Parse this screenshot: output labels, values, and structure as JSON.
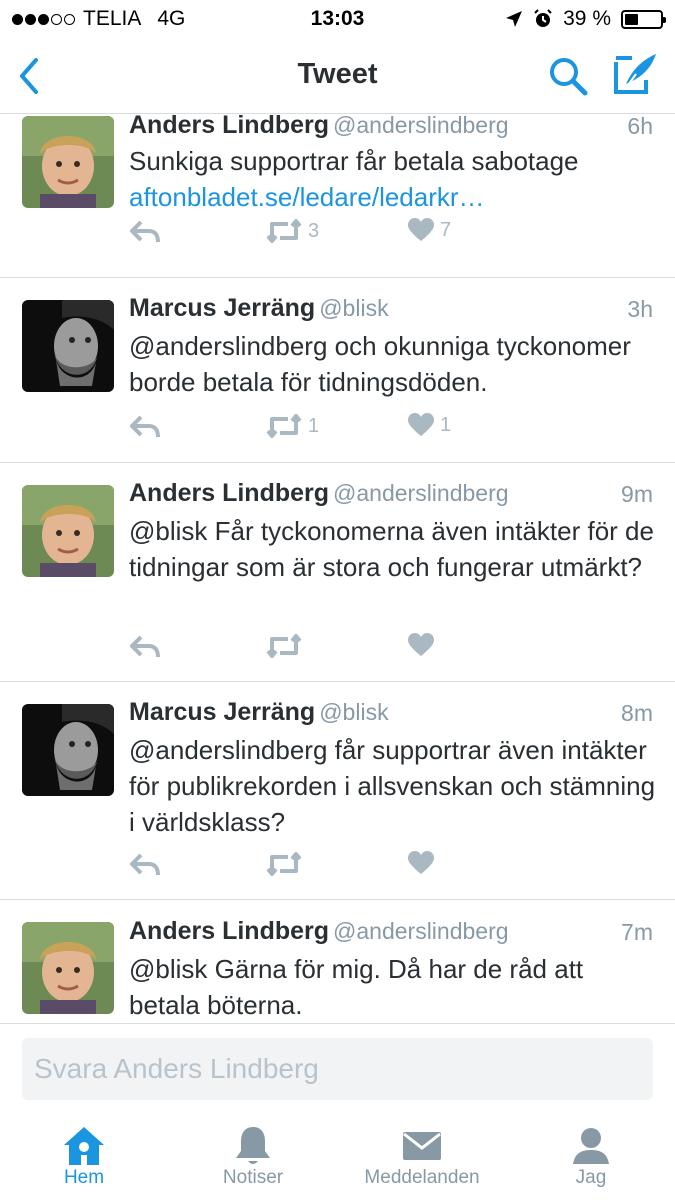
{
  "status_bar": {
    "carrier": "TELIA",
    "network": "4G",
    "time": "13:03",
    "battery": "39 %",
    "battery_level": 0.39
  },
  "nav": {
    "title": "Tweet",
    "icons": [
      "back-icon",
      "search-icon",
      "compose-icon"
    ],
    "accent_color": "#1b95e0"
  },
  "tweets": [
    {
      "name": "Anders Lindberg",
      "handle": "@anderslindberg",
      "time": "6h",
      "text": "Sunkiga supportrar får betala sabotage",
      "link": "aftonbladet.se/ledare/ledarkr…",
      "retweets": "3",
      "likes": "7"
    },
    {
      "name": "Marcus Jerräng",
      "handle": "@blisk",
      "time": "3h",
      "text": "@anderslindberg och okunniga tyckonomer borde betala för tidningsdöden.",
      "retweets": "1",
      "likes": "1"
    },
    {
      "name": "Anders Lindberg",
      "handle": "@anderslindberg",
      "time": "9m",
      "text": "@blisk Får tyckonomerna även intäkter för de tidningar som är stora och fungerar utmärkt?",
      "retweets": "",
      "likes": ""
    },
    {
      "name": "Marcus Jerräng",
      "handle": "@blisk",
      "time": "8m",
      "text": "@anderslindberg får supportrar även intäkter för publikrekorden i allsvenskan och stämning i världsklass?",
      "retweets": "",
      "likes": ""
    },
    {
      "name": "Anders Lindberg",
      "handle": "@anderslindberg",
      "time": "7m",
      "text": "@blisk Gärna för mig. Då har de råd att betala böterna."
    }
  ],
  "reply": {
    "placeholder": "Svara Anders Lindberg"
  },
  "tabs": [
    {
      "label": "Hem",
      "icon": "home-icon",
      "active": true
    },
    {
      "label": "Notiser",
      "icon": "bell-icon",
      "active": false
    },
    {
      "label": "Meddelanden",
      "icon": "envelope-icon",
      "active": false
    },
    {
      "label": "Jag",
      "icon": "person-icon",
      "active": false
    }
  ]
}
